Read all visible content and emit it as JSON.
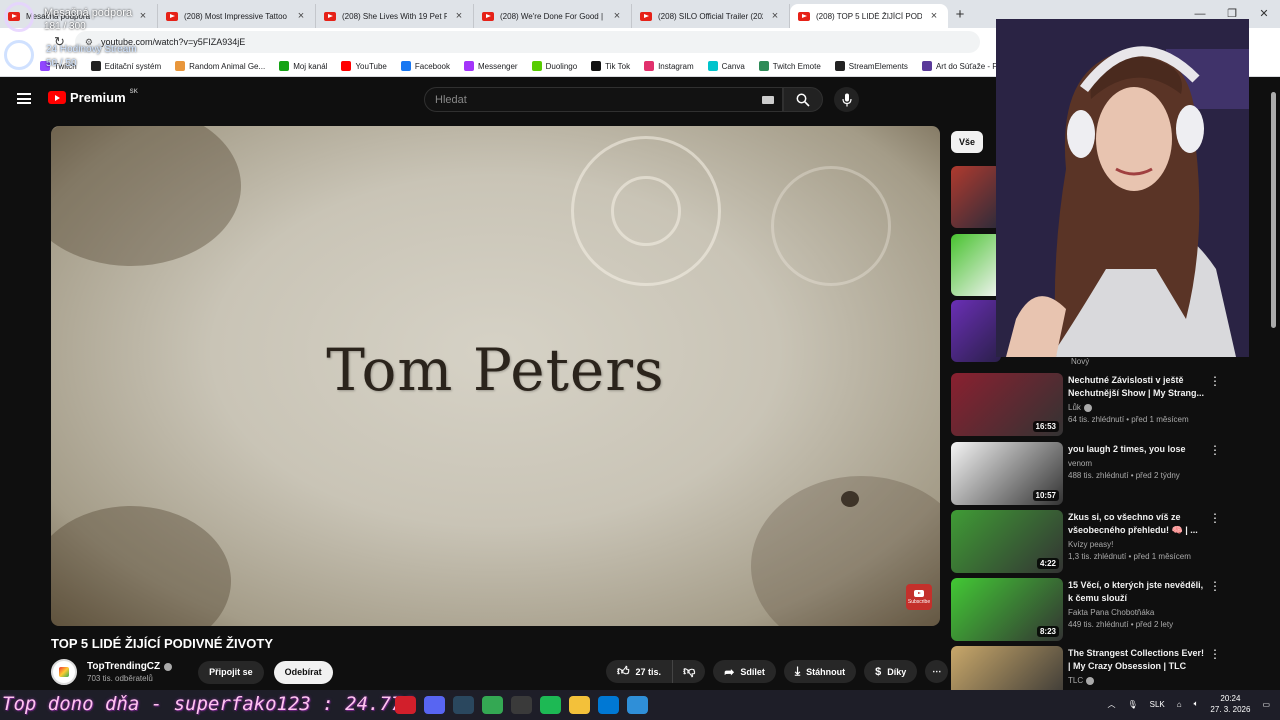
{
  "browser": {
    "tabs": [
      {
        "title": "Mesačná podpora"
      },
      {
        "title": "(208) Most Impressive Tattoo T"
      },
      {
        "title": "(208) She Lives With 19 Pet Rat"
      },
      {
        "title": "(208) We're Done For Good | H"
      },
      {
        "title": "(208) SILO Official Trailer (2023)"
      },
      {
        "title": "(208) TOP 5 LIDÉ ŽIJÍCÍ PODIVN"
      }
    ],
    "new_tab": "+",
    "url": "youtube.com/watch?v=y5FIZA934jE",
    "bookmarks": [
      {
        "label": "Twitch",
        "color": "#9146ff"
      },
      {
        "label": "Editační systém",
        "color": "#222222"
      },
      {
        "label": "Random Animal Ge...",
        "color": "#e8963b"
      },
      {
        "label": "Moj kanál",
        "color": "#15a315"
      },
      {
        "label": "YouTube",
        "color": "#ff0000"
      },
      {
        "label": "Facebook",
        "color": "#1877f2"
      },
      {
        "label": "Messenger",
        "color": "#a334fa"
      },
      {
        "label": "Duolingo",
        "color": "#58cc02"
      },
      {
        "label": "Tik Tok",
        "color": "#111111"
      },
      {
        "label": "Instagram",
        "color": "#e1306c"
      },
      {
        "label": "Canva",
        "color": "#00c4cc"
      },
      {
        "label": "Twitch Emote",
        "color": "#2e8b57"
      },
      {
        "label": "StreamElements",
        "color": "#222222"
      },
      {
        "label": "Art do Súťaže - For...",
        "color": "#5a3a9a"
      }
    ]
  },
  "overlay": {
    "goal_label": "Mesačná podpora",
    "goal_progress": "181 / 300",
    "stream_label": "24 Hodinový Stream",
    "stream_progress": "50 / 50"
  },
  "youtube": {
    "logo": "Premium",
    "logo_region": "SK",
    "search_placeholder": "Hledat",
    "video_overlay_text": "Tom Peters",
    "subscribe_badge": "Subscribe",
    "video_title": "TOP 5 LIDÉ ŽIJÍCÍ PODIVNÉ ŽIVOTY",
    "channel_name": "TopTrendingCZ",
    "channel_subs": "703 tis. odběratelů",
    "join_label": "Připojit se",
    "subscribe_label": "Odebírat",
    "likes": "27 tis.",
    "share_label": "Sdílet",
    "download_label": "Stáhnout",
    "thanks_label": "Díky",
    "filter_chip": "Vše",
    "new_label": "Nový",
    "recommendations": [
      {
        "title": "Nechutné Závislosti v ještě Nechutnější Show | My Strang...",
        "channel": "Lůk",
        "verified": true,
        "views": "64 tis. zhlédnutí",
        "age": "před 1 měsícem",
        "duration": "16:53",
        "thumb": "#8a2030"
      },
      {
        "title": "you laugh 2 times, you lose",
        "channel": "venom",
        "verified": false,
        "views": "488 tis. zhlédnutí",
        "age": "před 2 týdny",
        "duration": "10:57",
        "thumb": "#f4f4f4"
      },
      {
        "title": "Zkus si, co všechno víš ze všeobecného přehledu! 🧠 | ...",
        "channel": "Kvízy peasy!",
        "verified": false,
        "views": "1,3 tis. zhlédnutí",
        "age": "před 1 měsícem",
        "duration": "4:22",
        "thumb": "#3f9c35"
      },
      {
        "title": "15 Věcí, o kterých jste nevěděli, k čemu slouží",
        "channel": "Fakta Pana Chobotňáka",
        "verified": false,
        "views": "449 tis. zhlédnutí",
        "age": "před 2 lety",
        "duration": "8:23",
        "thumb": "#42c934"
      },
      {
        "title": "The Strangest Collections Ever! | My Crazy Obsession | TLC",
        "channel": "TLC",
        "verified": true,
        "views": "",
        "age": "",
        "duration": "",
        "thumb": "#c9a86a"
      }
    ]
  },
  "taskbar": {
    "donor_text": "Top dono dňa - superfako123 : 24.77€",
    "lang": "SLK",
    "time": "20:24",
    "date": "27. 3. 2026",
    "icons": [
      {
        "name": "opera-icon",
        "color": "#d21f2b"
      },
      {
        "name": "discord-icon",
        "color": "#5865f2"
      },
      {
        "name": "steam-icon",
        "color": "#2a475e"
      },
      {
        "name": "chrome-icon",
        "color": "#34a853"
      },
      {
        "name": "obs-icon",
        "color": "#3a3a3a"
      },
      {
        "name": "spotify-icon",
        "color": "#1db954"
      },
      {
        "name": "file-explorer-icon",
        "color": "#f3c13a"
      },
      {
        "name": "store-icon",
        "color": "#0078d4"
      },
      {
        "name": "photos-icon",
        "color": "#2f8fd8"
      }
    ]
  }
}
